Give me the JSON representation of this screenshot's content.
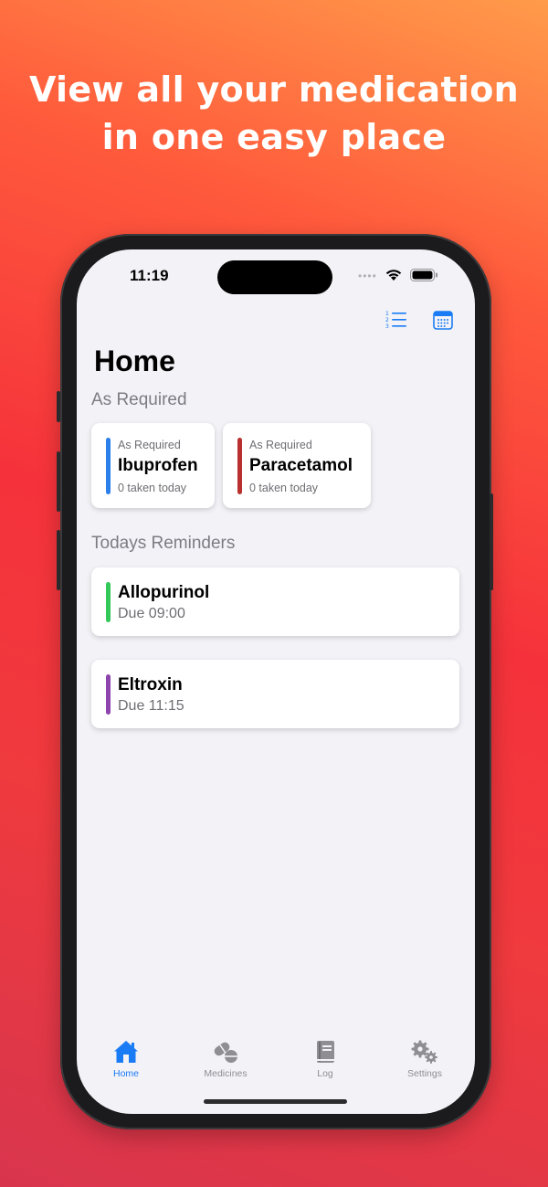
{
  "marketing": {
    "headline_line1": "View all your medication",
    "headline_line2": "in one easy place"
  },
  "status_bar": {
    "time": "11:19",
    "signal": "••••"
  },
  "nav": {
    "list_icon": "numbered-list-icon",
    "calendar_icon": "calendar-icon"
  },
  "page": {
    "title": "Home"
  },
  "as_required": {
    "heading": "As Required",
    "items": [
      {
        "kind": "As Required",
        "name": "Ibuprofen",
        "count": "0 taken today",
        "color": "#2b7fe8"
      },
      {
        "kind": "As Required",
        "name": "Paracetamol",
        "count": "0 taken today",
        "color": "#b8312f"
      }
    ]
  },
  "reminders": {
    "heading": "Todays Reminders",
    "items": [
      {
        "name": "Allopurinol",
        "due": "Due 09:00",
        "color": "#34c759"
      },
      {
        "name": "Eltroxin",
        "due": "Due 11:15",
        "color": "#8e44ad"
      }
    ]
  },
  "tab_bar": {
    "tabs": [
      {
        "label": "Home",
        "icon": "house-icon",
        "active": true
      },
      {
        "label": "Medicines",
        "icon": "pills-icon",
        "active": false
      },
      {
        "label": "Log",
        "icon": "book-icon",
        "active": false
      },
      {
        "label": "Settings",
        "icon": "gears-icon",
        "active": false
      }
    ]
  },
  "colors": {
    "accent": "#1a7cf4",
    "inactive": "#8e8e93",
    "background": "#f2f2f7"
  }
}
